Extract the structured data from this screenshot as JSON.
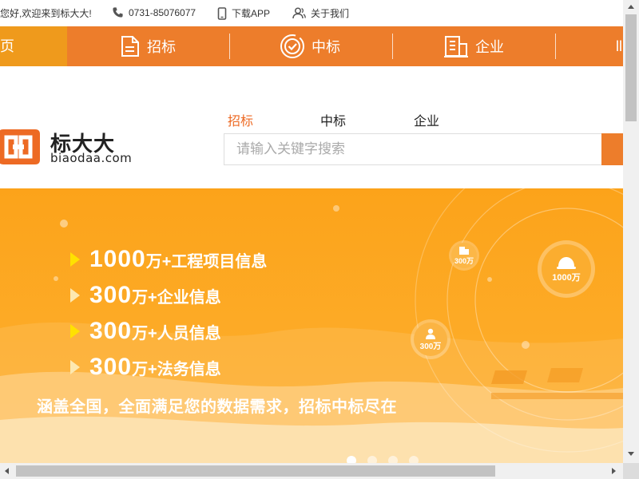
{
  "topbar": {
    "greeting": "您好,欢迎来到标大大!",
    "phone": "0731-85076077",
    "download": "下载APP",
    "about": "关于我们"
  },
  "nav": {
    "home": "首页",
    "items": [
      {
        "label": "招标",
        "icon": "document-icon"
      },
      {
        "label": "中标",
        "icon": "target-check-icon"
      },
      {
        "label": "企业",
        "icon": "building-icon"
      }
    ],
    "partial_label": "ll"
  },
  "logo": {
    "brand": "标大大",
    "domain": "biaodaa.com"
  },
  "search": {
    "tabs": [
      "招标",
      "中标",
      "企业"
    ],
    "active_tab": "招标",
    "placeholder": "请输入关键字搜索"
  },
  "banner": {
    "lines": [
      {
        "num": "1000",
        "text": "万+工程项目信息"
      },
      {
        "num": "300",
        "text": "万+企业信息"
      },
      {
        "num": "300",
        "text": "万+人员信息"
      },
      {
        "num": "300",
        "text": "万+法务信息"
      }
    ],
    "slogan": "涵盖全国，全面满足您的数据需求，招标中标尽在",
    "badges": [
      {
        "label": "300万",
        "icon": "building-icon"
      },
      {
        "label": "1000万",
        "icon": "helmet-icon"
      },
      {
        "label": "300万",
        "icon": "person-icon"
      }
    ],
    "slides_total": 4,
    "slide_active": 1
  },
  "colors": {
    "accent": "#ed7d2b",
    "nav_home": "#ef9a1c",
    "banner": "#fca31a",
    "highlight": "#ffe100"
  }
}
